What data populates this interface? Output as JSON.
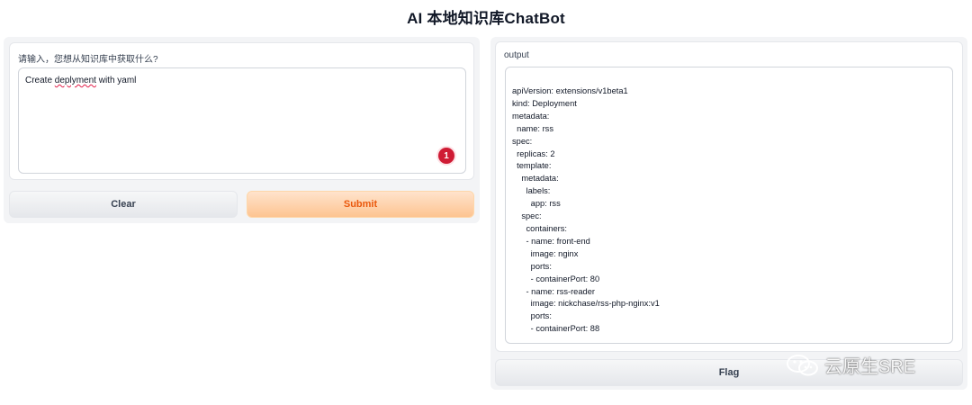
{
  "app": {
    "title": "AI 本地知识库ChatBot"
  },
  "input": {
    "label": "请输入，您想从知识库中获取什么?",
    "value_prefix": "Create ",
    "value_misspelled": "deplyment",
    "value_suffix": " with yaml",
    "badge_count": "1"
  },
  "buttons": {
    "clear": "Clear",
    "submit": "Submit",
    "flag": "Flag"
  },
  "output": {
    "label": "output",
    "lines": [
      "apiVersion: extensions/v1beta1",
      "kind: Deployment",
      "metadata:",
      "  name: rss",
      "spec:",
      "  replicas: 2",
      "  template:",
      "    metadata:",
      "      labels:",
      "        app: rss",
      "    spec:",
      "      containers:",
      "      - name: front-end",
      "        image: nginx",
      "        ports:",
      "        - containerPort: 80",
      "      - name: rss-reader",
      "        image: nickchase/rss-php-nginx:v1",
      "        ports:",
      "        - containerPort: 88"
    ]
  },
  "watermark": {
    "text": "云原生SRE",
    "icon": "wechat-icon"
  },
  "colors": {
    "submit_text": "#ea580c",
    "badge": "#cf1b34"
  }
}
